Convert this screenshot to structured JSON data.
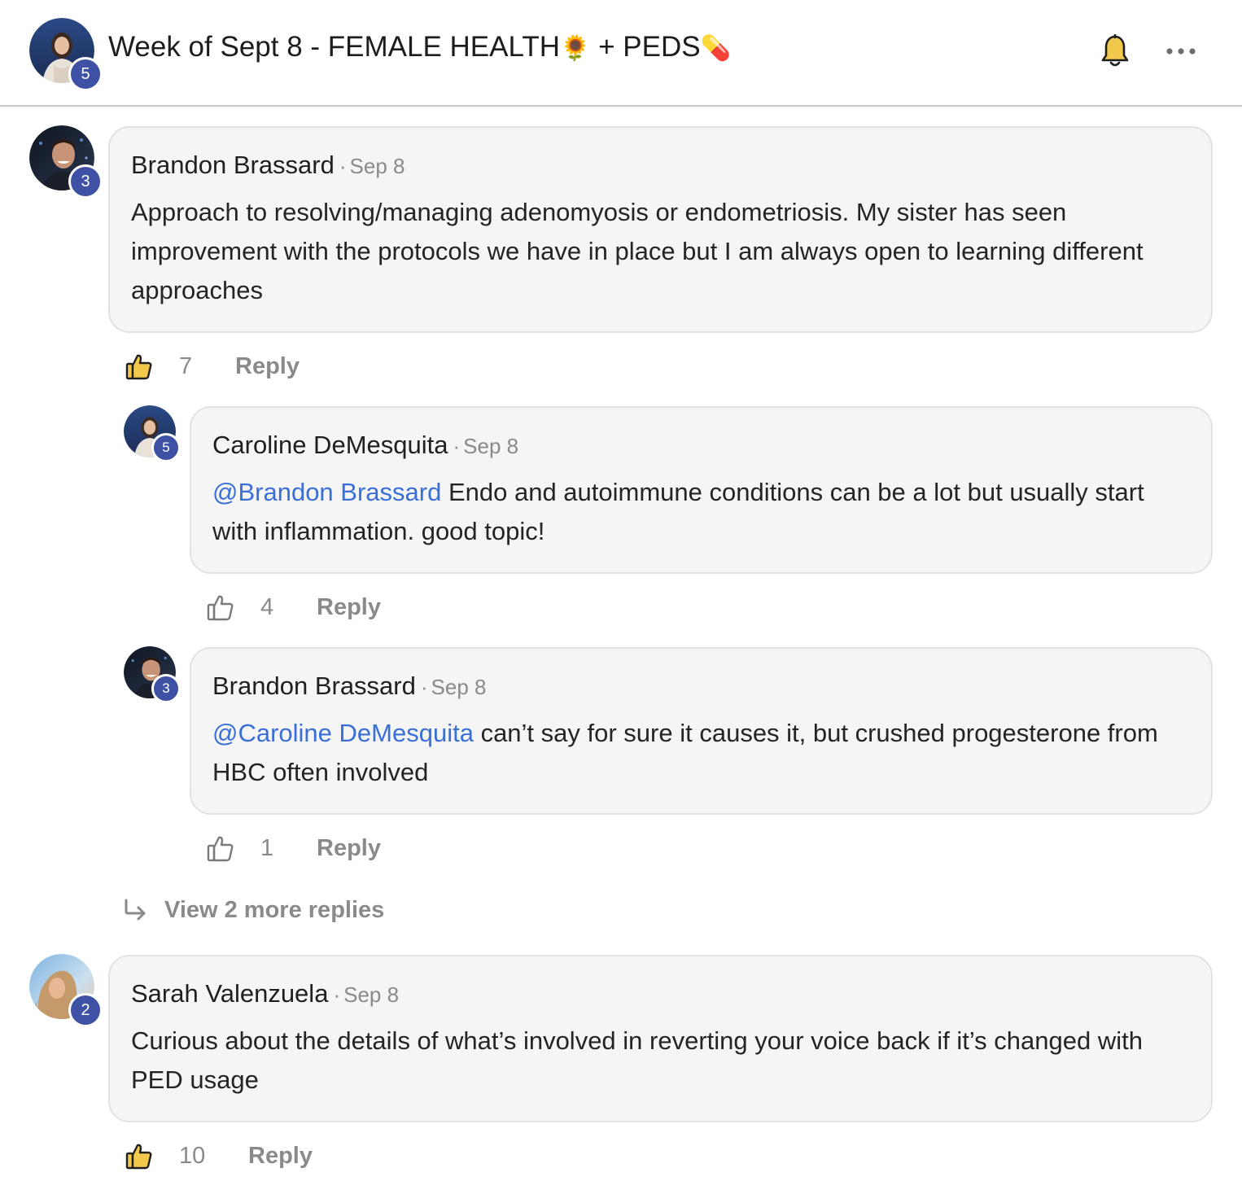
{
  "post": {
    "title_text": "Week of Sept 8 - FEMALE HEALTH",
    "title_emoji_1": "🌻",
    "title_mid": " + PEDS",
    "title_emoji_2": "💊",
    "author_level": "5"
  },
  "comments": [
    {
      "author": "Brandon Brassard",
      "separator": "·",
      "date": "Sep 8",
      "level": "3",
      "mention": "",
      "text": "Approach to resolving/managing adenomyosis or endometriosis. My sister has seen improvement with the protocols we have in place but I am always open to learning different approaches",
      "likes": "7",
      "reply_label": "Reply",
      "liked": true
    },
    {
      "author": "Caroline DeMesquita",
      "separator": "·",
      "date": "Sep 8",
      "level": "5",
      "mention": "@Brandon Brassard",
      "text": " Endo and autoimmune conditions can be a lot but usually start with inflammation. good topic!",
      "likes": "4",
      "reply_label": "Reply",
      "liked": false
    },
    {
      "author": "Brandon Brassard",
      "separator": "·",
      "date": "Sep 8",
      "level": "3",
      "mention": "@Caroline DeMesquita",
      "text": " can’t say for sure it causes it, but crushed progesterone from HBC often involved",
      "likes": "1",
      "reply_label": "Reply",
      "liked": false
    },
    {
      "author": "Sarah Valenzuela",
      "separator": "·",
      "date": "Sep 8",
      "level": "2",
      "mention": "",
      "text": "Curious about the details of what’s involved in reverting your voice back if it’s changed with PED usage",
      "likes": "10",
      "reply_label": "Reply",
      "liked": true
    }
  ],
  "view_more_replies": "View 2 more replies",
  "icons": {
    "notifications": "bell-icon",
    "menu": "more-horizontal-icon",
    "like": "thumbs-up-icon",
    "view_replies": "reply-arrow-icon"
  },
  "colors": {
    "level_badge": "#3f51a5",
    "mention": "#3a6fd8",
    "liked_fill": "#f2c94c",
    "muted_text": "#8a8a8a",
    "card_bg": "#f5f5f5"
  }
}
